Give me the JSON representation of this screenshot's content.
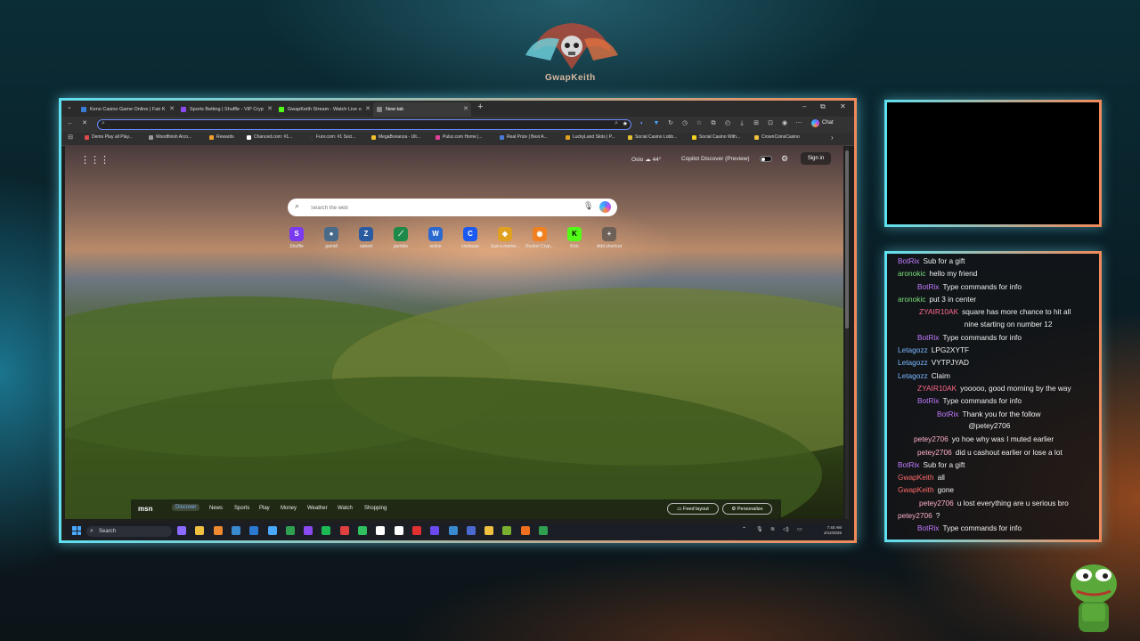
{
  "overlay": {
    "logo_text": "GwapKeith"
  },
  "browser": {
    "tabs": [
      {
        "label": "Keno Casino Game Online | Fair K",
        "color": "#3a7bd5"
      },
      {
        "label": "Sports Betting | Shuffle - VIP Cryp",
        "color": "#8a4af0"
      },
      {
        "label": "GwapKeith Stream - Watch Live o",
        "color": "#53fc18"
      },
      {
        "label": "New tab",
        "color": "#888888"
      }
    ],
    "new_tab_symbol": "+",
    "window_controls": {
      "minimize": "–",
      "maximize": "⧉",
      "close": "✕"
    },
    "address_value": "",
    "copilot_chat": "Chat",
    "bookmarks": [
      {
        "label": "Demo Play all Play...",
        "color": "#e04a4a"
      },
      {
        "label": "Woodfinish Arco...",
        "color": "#999999"
      },
      {
        "label": "Rewards",
        "color": "#f0a030"
      },
      {
        "label": "Chanced.com: #1...",
        "color": "#ffffff"
      },
      {
        "label": "Funr.com: #1 Soci...",
        "color": "#333333"
      },
      {
        "label": "MegaBonanza - Ult...",
        "color": "#f0c030"
      },
      {
        "label": "Pulsz.com Home |...",
        "color": "#e0409a"
      },
      {
        "label": "Real Prize | Best A...",
        "color": "#4a7ad5"
      },
      {
        "label": "LuckyLand Slots | P...",
        "color": "#e0a020"
      },
      {
        "label": "Social Casino Lobb...",
        "color": "#e0c030"
      },
      {
        "label": "Social Casino With...",
        "color": "#f0d020"
      },
      {
        "label": "CrownCoinsCasino",
        "color": "#f0c040"
      }
    ],
    "newtab": {
      "apps_icon": "⋮⋮⋮",
      "weather_city": "Oslo",
      "weather_temp": "44°",
      "copilot_discover": "Copilot Discover (Preview)",
      "sign_in": "Sign in",
      "search_placeholder": "Search the web",
      "shortcuts": [
        {
          "label": "Shuffle",
          "glyph": "S",
          "color": "#7a3af0"
        },
        {
          "label": "gamdl",
          "glyph": "●",
          "color": "#4a6a8a"
        },
        {
          "label": "rained",
          "glyph": "Z",
          "color": "#2a5aa0"
        },
        {
          "label": "gamble",
          "glyph": "⟋",
          "color": "#1e8a4a"
        },
        {
          "label": "wolnn",
          "glyph": "W",
          "color": "#2a6ad0"
        },
        {
          "label": "coinbase",
          "glyph": "C",
          "color": "#1a5af0"
        },
        {
          "label": "Just a mome...",
          "glyph": "◆",
          "color": "#e0a020"
        },
        {
          "label": "Rocket Cryp...",
          "glyph": "◉",
          "color": "#f08020"
        },
        {
          "label": "Kick",
          "glyph": "K",
          "color": "#53fc18"
        },
        {
          "label": "Add shortcut",
          "glyph": "+",
          "color": "#555555"
        }
      ],
      "msn": {
        "logo": "msn",
        "tabs": [
          "Discover",
          "News",
          "Sports",
          "Play",
          "Money",
          "Weather",
          "Watch",
          "Shopping"
        ],
        "feed_layout": "Feed layout",
        "personalize": "Personalize"
      }
    },
    "taskbar": {
      "search_label": "Search",
      "time": "7:40 AM",
      "date": "4/12/2026",
      "app_colors": [
        "#8a6aff",
        "#f0c040",
        "#f08a30",
        "#3a8ad0",
        "#2a7ad0",
        "#4aa8ff",
        "#30a050",
        "#8a4af0",
        "#1db954",
        "#e04040",
        "#30c060",
        "#ffffff",
        "#ffffff",
        "#e03030",
        "#6a4af0",
        "#3a8ad0",
        "#4a6ad0",
        "#f0c040",
        "#7ab030",
        "#f07020",
        "#30a050"
      ]
    }
  },
  "chat": {
    "messages": [
      {
        "user": "BotRix",
        "text": "Sub for a gift",
        "ucolor": "#c47bff",
        "indent": 0
      },
      {
        "user": "aronokic",
        "text": "hello my friend",
        "ucolor": "#7be07b",
        "indent": 0
      },
      {
        "user": "BotRix",
        "text": "Type commands for info",
        "ucolor": "#c47bff",
        "indent": 22
      },
      {
        "user": "aronokic",
        "text": "put 3 in center",
        "ucolor": "#7be07b",
        "indent": 0
      },
      {
        "user": "ZYAIR10AK",
        "text": "square has more chance to hit all",
        "ucolor": "#ff6a8a",
        "indent": 24,
        "cont": "nine starting on number 12"
      },
      {
        "user": "BotRix",
        "text": "Type commands for info",
        "ucolor": "#c47bff",
        "indent": 22
      },
      {
        "user": "Letagozz",
        "text": "LPG2XYTF",
        "ucolor": "#7ab8ff",
        "indent": 0
      },
      {
        "user": "Letagozz",
        "text": "VYTPJYAD",
        "ucolor": "#7ab8ff",
        "indent": 0
      },
      {
        "user": "Letagozz",
        "text": "Claim",
        "ucolor": "#7ab8ff",
        "indent": 0
      },
      {
        "user": "ZYAIR10AK",
        "text": "yooooo, good morning by the way",
        "ucolor": "#ff6a8a",
        "indent": 22
      },
      {
        "user": "BotRix",
        "text": "Type commands for info",
        "ucolor": "#c47bff",
        "indent": 22
      },
      {
        "user": "BotRix",
        "text": "Thank you for the follow",
        "ucolor": "#c47bff",
        "indent": 44,
        "cont": "@petey2706"
      },
      {
        "user": "petey2706",
        "text": "yo hoe why was I muted earlier",
        "ucolor": "#ffb0c8",
        "indent": 18
      },
      {
        "user": "petey2706",
        "text": "did u cashout earlier or lose a lot",
        "ucolor": "#ffb0c8",
        "indent": 22
      },
      {
        "user": "BotRix",
        "text": "Sub for a gift",
        "ucolor": "#c47bff",
        "indent": 0
      },
      {
        "user": "GwapKeith",
        "text": "all",
        "ucolor": "#ff6a6a",
        "indent": 0
      },
      {
        "user": "GwapKeith",
        "text": "gone",
        "ucolor": "#ff6a6a",
        "indent": 0
      },
      {
        "user": "petey2706",
        "text": "u lost everything are u serious bro",
        "ucolor": "#ffb0c8",
        "indent": 24
      },
      {
        "user": "petey2706",
        "text": "?",
        "ucolor": "#ffb0c8",
        "indent": 0
      },
      {
        "user": "BotRix",
        "text": "Type commands for info",
        "ucolor": "#c47bff",
        "indent": 22
      }
    ]
  }
}
